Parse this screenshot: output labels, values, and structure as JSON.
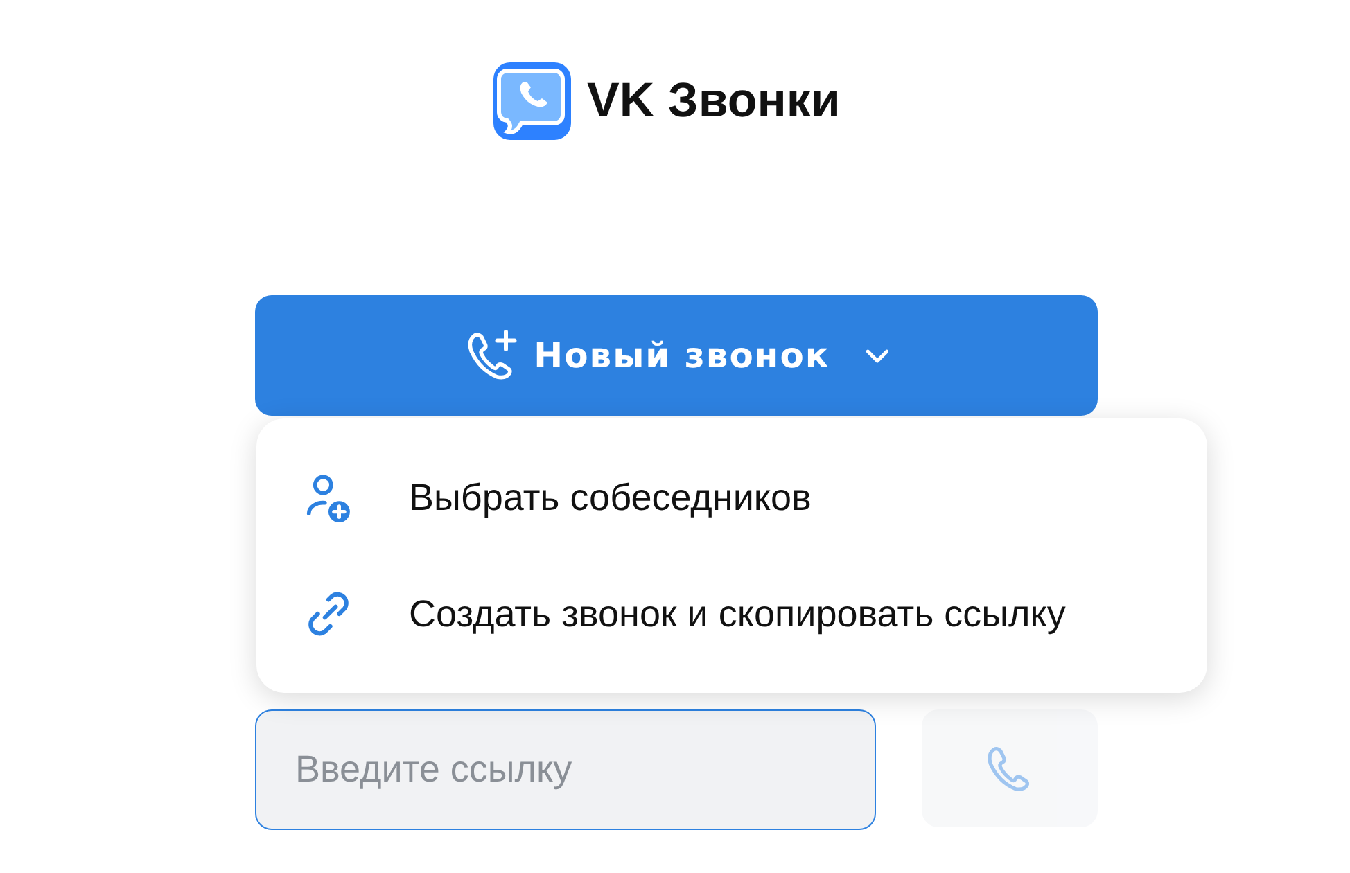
{
  "logo": {
    "title": "VK Звонки"
  },
  "new_call_button": {
    "label": "Новый звонок",
    "expanded": true
  },
  "menu": [
    {
      "kind": "add-person",
      "label": "Выбрать собеседников"
    },
    {
      "kind": "link",
      "label": "Создать звонок и скопировать ссылку"
    }
  ],
  "link_field": {
    "placeholder": "Введите ссылку",
    "focused": true
  },
  "call_button": {
    "disabled": true
  }
}
